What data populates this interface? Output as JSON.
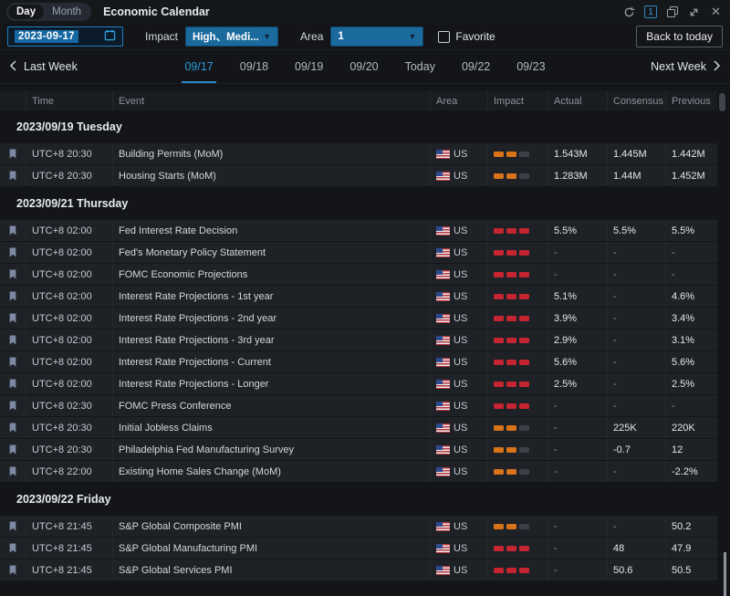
{
  "titlebar": {
    "view_tabs": {
      "day": "Day",
      "month": "Month"
    },
    "title": "Economic Calendar",
    "window_count": "1"
  },
  "filters": {
    "date_value": "2023-09-17",
    "impact_label": "Impact",
    "impact_value": "High、Medi...",
    "area_label": "Area",
    "area_value": "1",
    "favorite_label": "Favorite",
    "back_to_today_label": "Back to today"
  },
  "week_nav": {
    "prev_label": "Last Week",
    "next_label": "Next Week",
    "days": [
      {
        "label": "09/17",
        "active": true
      },
      {
        "label": "09/18",
        "active": false
      },
      {
        "label": "09/19",
        "active": false
      },
      {
        "label": "09/20",
        "active": false
      },
      {
        "label": "Today",
        "active": false
      },
      {
        "label": "09/22",
        "active": false
      },
      {
        "label": "09/23",
        "active": false
      }
    ]
  },
  "table": {
    "headers": [
      "Time",
      "Event",
      "Area",
      "Impact",
      "Actual",
      "Consensus",
      "Previous"
    ],
    "sections": [
      {
        "date": "2023/09/19 Tuesday",
        "rows": [
          {
            "time": "UTC+8 20:30",
            "event": "Building Permits (MoM)",
            "area": "US",
            "impact": "medium",
            "actual": "1.543M",
            "consensus": "1.445M",
            "previous": "1.442M"
          },
          {
            "time": "UTC+8 20:30",
            "event": "Housing Starts (MoM)",
            "area": "US",
            "impact": "medium",
            "actual": "1.283M",
            "consensus": "1.44M",
            "previous": "1.452M"
          }
        ]
      },
      {
        "date": "2023/09/21 Thursday",
        "rows": [
          {
            "time": "UTC+8 02:00",
            "event": "Fed Interest Rate Decision",
            "area": "US",
            "impact": "high",
            "actual": "5.5%",
            "consensus": "5.5%",
            "previous": "5.5%"
          },
          {
            "time": "UTC+8 02:00",
            "event": "Fed's Monetary Policy Statement",
            "area": "US",
            "impact": "high",
            "actual": "-",
            "consensus": "-",
            "previous": "-"
          },
          {
            "time": "UTC+8 02:00",
            "event": "FOMC Economic Projections",
            "area": "US",
            "impact": "high",
            "actual": "-",
            "consensus": "-",
            "previous": "-"
          },
          {
            "time": "UTC+8 02:00",
            "event": "Interest Rate Projections - 1st year",
            "area": "US",
            "impact": "high",
            "actual": "5.1%",
            "consensus": "-",
            "previous": "4.6%"
          },
          {
            "time": "UTC+8 02:00",
            "event": "Interest Rate Projections - 2nd year",
            "area": "US",
            "impact": "high",
            "actual": "3.9%",
            "consensus": "-",
            "previous": "3.4%"
          },
          {
            "time": "UTC+8 02:00",
            "event": "Interest Rate Projections - 3rd year",
            "area": "US",
            "impact": "high",
            "actual": "2.9%",
            "consensus": "-",
            "previous": "3.1%"
          },
          {
            "time": "UTC+8 02:00",
            "event": "Interest Rate Projections - Current",
            "area": "US",
            "impact": "high",
            "actual": "5.6%",
            "consensus": "-",
            "previous": "5.6%"
          },
          {
            "time": "UTC+8 02:00",
            "event": "Interest Rate Projections - Longer",
            "area": "US",
            "impact": "high",
            "actual": "2.5%",
            "consensus": "-",
            "previous": "2.5%"
          },
          {
            "time": "UTC+8 02:30",
            "event": "FOMC Press Conference",
            "area": "US",
            "impact": "high",
            "actual": "-",
            "consensus": "-",
            "previous": "-"
          },
          {
            "time": "UTC+8 20:30",
            "event": "Initial Jobless Claims",
            "area": "US",
            "impact": "medium",
            "actual": "-",
            "consensus": "225K",
            "previous": "220K"
          },
          {
            "time": "UTC+8 20:30",
            "event": "Philadelphia Fed Manufacturing Survey",
            "area": "US",
            "impact": "medium",
            "actual": "-",
            "consensus": "-0.7",
            "previous": "12"
          },
          {
            "time": "UTC+8 22:00",
            "event": "Existing Home Sales Change (MoM)",
            "area": "US",
            "impact": "medium",
            "actual": "-",
            "consensus": "-",
            "previous": "-2.2%"
          }
        ]
      },
      {
        "date": "2023/09/22 Friday",
        "rows": [
          {
            "time": "UTC+8 21:45",
            "event": "S&P Global Composite PMI",
            "area": "US",
            "impact": "medium",
            "actual": "-",
            "consensus": "-",
            "previous": "50.2"
          },
          {
            "time": "UTC+8 21:45",
            "event": "S&P Global Manufacturing PMI",
            "area": "US",
            "impact": "high",
            "actual": "-",
            "consensus": "48",
            "previous": "47.9"
          },
          {
            "time": "UTC+8 21:45",
            "event": "S&P Global Services PMI",
            "area": "US",
            "impact": "high",
            "actual": "-",
            "consensus": "50.6",
            "previous": "50.5"
          }
        ]
      }
    ]
  },
  "icons": {
    "dropdown_arrow": "▼",
    "close": "✕"
  },
  "colors": {
    "accent_blue": "#2e9ad9",
    "dropdown_fill": "#1a6a9e",
    "impact_high": "#c52531",
    "impact_medium": "#d9731a",
    "row_background": "#1e2126"
  }
}
